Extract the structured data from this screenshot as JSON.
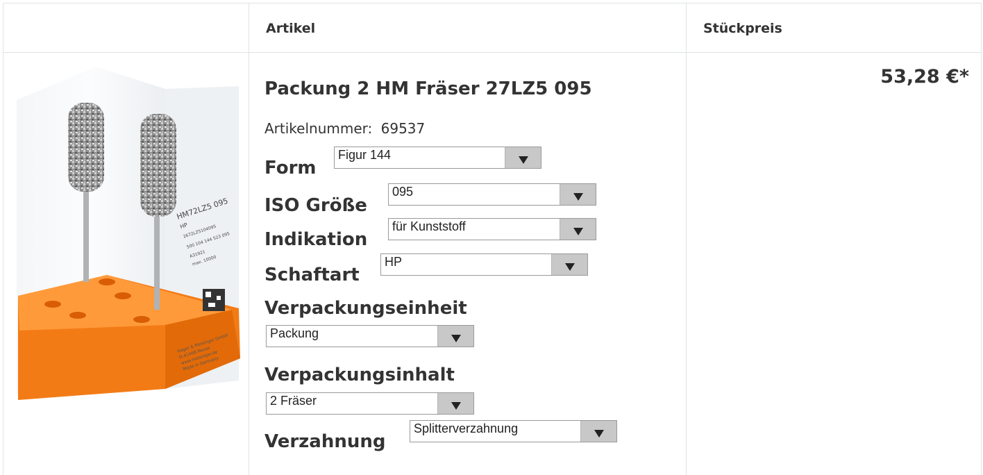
{
  "table": {
    "col_artikel": "Artikel",
    "col_stueckpreis": "Stückpreis"
  },
  "product": {
    "title": "Packung 2 HM Fräser 27LZ5 095",
    "artnum_label": "Artikelnummer:",
    "artnum_value": "69537",
    "price": "53,28 €*",
    "image_print": {
      "code": "HM72LZ5 095",
      "shank": "HP",
      "ref1": "REF",
      "ref1_val": "2672LZ5104095",
      "ref2": "REF",
      "ref2_val": "500 104 144 523 095",
      "lot": "LOT",
      "lot_val": "A31921",
      "max": "max. 10000",
      "company": "Hager & Meisinger GmbH",
      "addr": "D-41468 Neuss",
      "web": "www.meisinger.de",
      "made": "Made in Germany"
    }
  },
  "options": [
    {
      "label": "Form",
      "value": "Figur 144"
    },
    {
      "label": "ISO Größe",
      "value": "095"
    },
    {
      "label": "Indikation",
      "value": "für Kunststoff"
    },
    {
      "label": "Schaftart",
      "value": "HP"
    },
    {
      "label": "Verpackungseinheit",
      "value": "Packung"
    },
    {
      "label": "Verpackungsinhalt",
      "value": "2 Fräser"
    },
    {
      "label": "Verzahnung",
      "value": "Splitterverzahnung"
    }
  ],
  "colors": {
    "border": "#dfe3e6",
    "orange": "#f7750f",
    "select_button": "#c8c8c8"
  }
}
